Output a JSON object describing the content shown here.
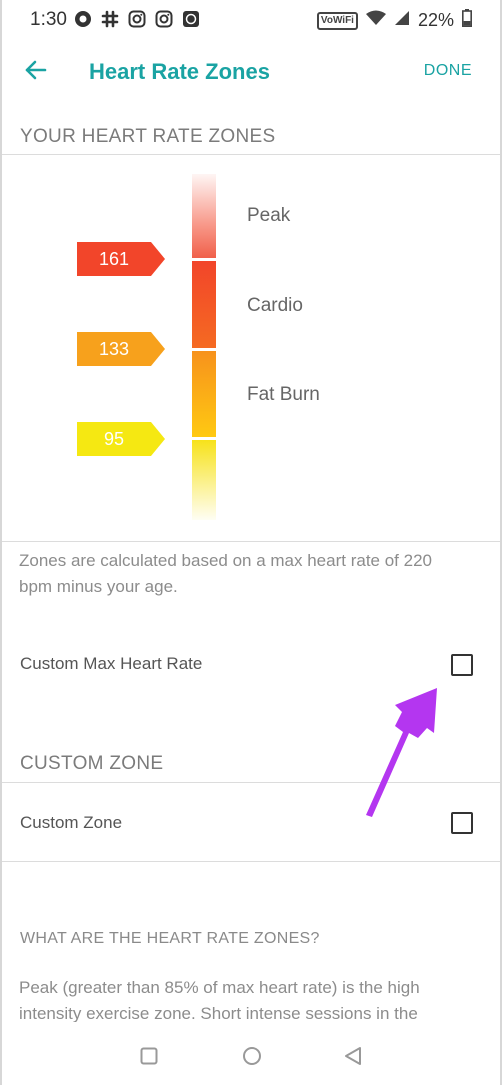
{
  "status_bar": {
    "time": "1:30",
    "network_badge": "VoWiFi",
    "battery_percent": "22%"
  },
  "app_bar": {
    "title": "Heart Rate Zones",
    "done_label": "DONE"
  },
  "zones_section": {
    "heading": "YOUR HEART RATE ZONES",
    "zones": [
      {
        "name": "Peak"
      },
      {
        "name": "Cardio",
        "lower_bpm": "161",
        "color": "#f2452a"
      },
      {
        "name": "Fat Burn",
        "lower_bpm": "133",
        "color": "#f7a11c"
      },
      {
        "name": "",
        "lower_bpm": "95",
        "color": "#f5e812"
      }
    ],
    "note": "Zones are calculated based on a max heart rate of 220 bpm minus your age."
  },
  "settings": {
    "custom_max_hr_label": "Custom Max Heart Rate",
    "custom_zone_heading": "CUSTOM ZONE",
    "custom_zone_label": "Custom Zone",
    "custom_max_hr_checked": false,
    "custom_zone_checked": false
  },
  "info": {
    "heading": "WHAT ARE THE HEART RATE ZONES?",
    "paragraph": "Peak (greater than 85% of max heart rate) is the high intensity exercise zone. Short intense sessions in the"
  },
  "colors": {
    "accent": "#1aa3a3",
    "annotation_arrow": "#b436f0"
  }
}
